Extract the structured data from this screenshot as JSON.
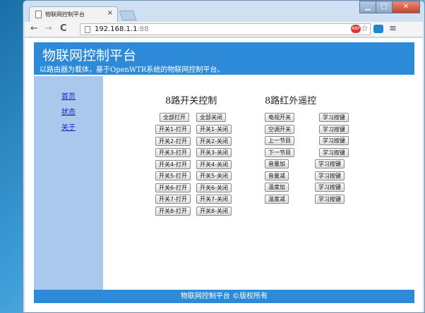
{
  "browser": {
    "tab_title": "物联网控制平台",
    "tab_close": "×",
    "window_controls": {
      "minimize": "▁",
      "maximize": "□",
      "close": "✕"
    },
    "nav": {
      "back": "←",
      "forward": "→",
      "reload": "C"
    },
    "url_host": "192.168.1.1",
    "url_port": ":88",
    "ext_badge": "ABP",
    "star": "☆",
    "menu": "≡"
  },
  "header": {
    "title": "物联网控制平台",
    "subtitle": "以路由器为载体，基于OpenWTR系统的物联网控制平台。"
  },
  "sidebar": {
    "items": [
      {
        "label": "首页"
      },
      {
        "label": "状态"
      },
      {
        "label": "关于"
      }
    ]
  },
  "switch_panel": {
    "title": "8路开关控制",
    "all_on": "全部打开",
    "all_off": "全部关闭",
    "rows": [
      {
        "on": "开关1-打开",
        "off": "开关1-关闭"
      },
      {
        "on": "开关2-打开",
        "off": "开关2-关闭"
      },
      {
        "on": "开关3-打开",
        "off": "开关3-关闭"
      },
      {
        "on": "开关4-打开",
        "off": "开关4-关闭"
      },
      {
        "on": "开关5-打开",
        "off": "开关5-关闭"
      },
      {
        "on": "开关6-打开",
        "off": "开关6-关闭"
      },
      {
        "on": "开关7-打开",
        "off": "开关7-关闭"
      },
      {
        "on": "开关8-打开",
        "off": "开关8-关闭"
      }
    ]
  },
  "ir_panel": {
    "title": "8路红外遥控",
    "rows": [
      {
        "action": "电视开关",
        "learn": "学习按键"
      },
      {
        "action": "空调开关",
        "learn": "学习按键"
      },
      {
        "action": "上一节目",
        "learn": "学习按键"
      },
      {
        "action": "下一节目",
        "learn": "学习按键"
      },
      {
        "action": "音量加",
        "learn": "学习按键"
      },
      {
        "action": "音量减",
        "learn": "学习按键"
      },
      {
        "action": "温度加",
        "learn": "学习按键"
      },
      {
        "action": "温度减",
        "learn": "学习按键"
      }
    ]
  },
  "footer": {
    "text": "物联网控制平台 ©版权所有"
  }
}
